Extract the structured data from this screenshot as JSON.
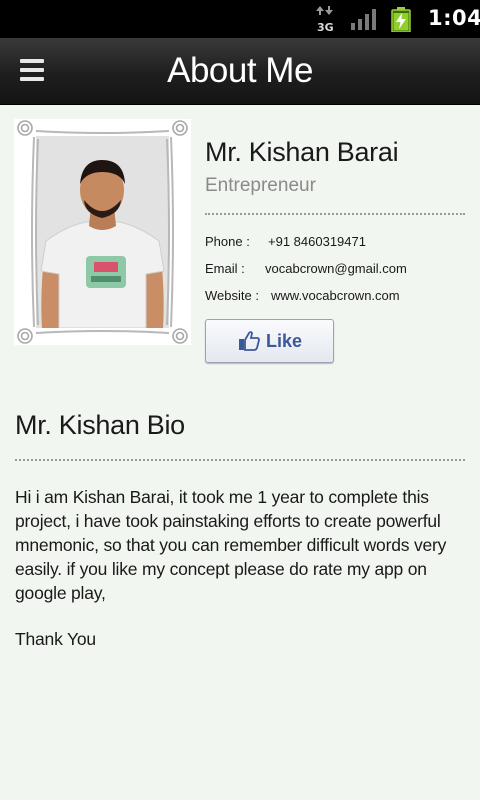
{
  "status_bar": {
    "network_type": "3G",
    "time": "1:04",
    "icons": [
      "data-arrows-icon",
      "signal-icon",
      "battery-charging-icon"
    ]
  },
  "action_bar": {
    "title": "About Me",
    "menu_icon": "menu-icon"
  },
  "profile": {
    "name": "Mr. Kishan Barai",
    "profession": "Entrepreneur",
    "phone_label": "Phone   :",
    "phone": "+91 8460319471",
    "email_label": "Email    :",
    "email": "vocabcrown@gmail.com",
    "website_label": "Website :",
    "website": "www.vocabcrown.com",
    "like_label": "Like"
  },
  "bio": {
    "title": "Mr. Kishan Bio",
    "text": "Hi i am Kishan Barai, it took me 1 year to complete this project, i have took painstaking efforts to create powerful mnemonic, so that you can remember difficult words very easily. if you like my concept please do rate my app on google play,",
    "thanks": "Thank You"
  },
  "colors": {
    "background": "#f2f6f0",
    "action_bar": "#1e1e1e",
    "facebook_blue": "#3b5998",
    "muted_text": "#8a8a8a"
  }
}
